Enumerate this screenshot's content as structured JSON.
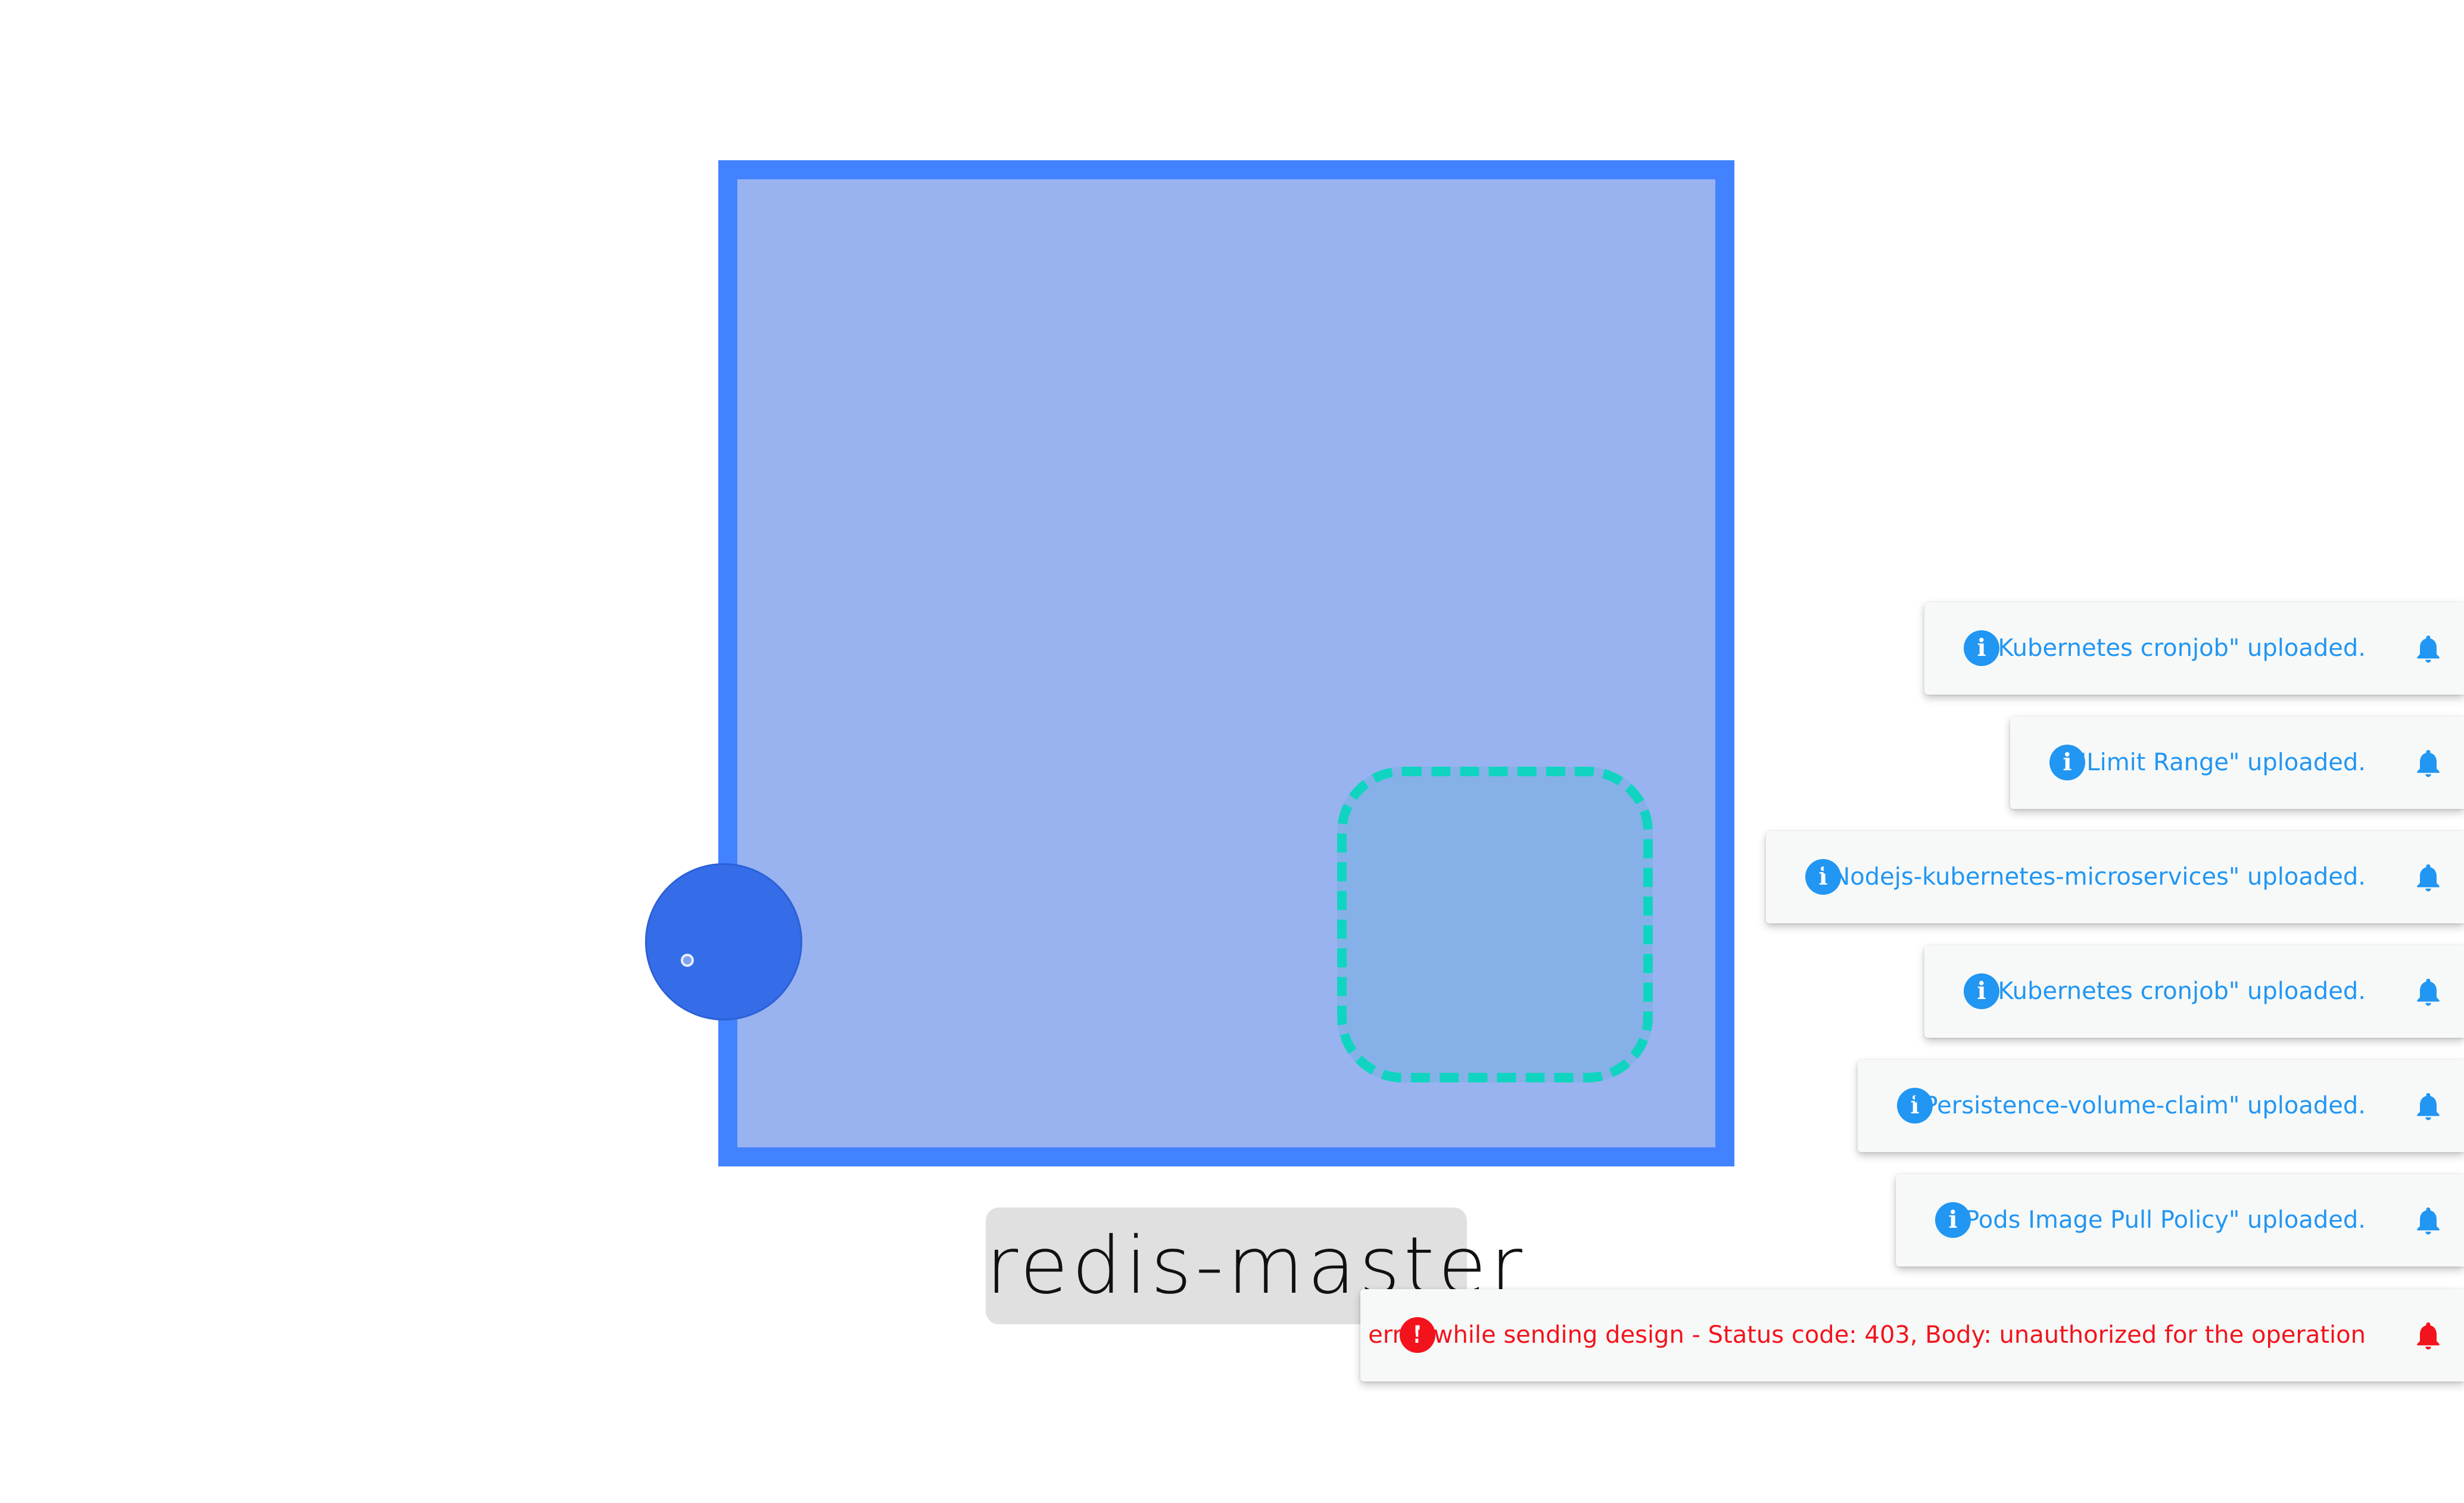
{
  "node": {
    "label": "redis-master"
  },
  "notifications": [
    {
      "type": "info",
      "icon": "info-icon",
      "message": "\"Kubernetes cronjob\" uploaded."
    },
    {
      "type": "info",
      "icon": "info-icon",
      "message": "\"Limit Range\" uploaded."
    },
    {
      "type": "info",
      "icon": "info-icon",
      "message": "\"Nodejs-kubernetes-microservices\" uploaded."
    },
    {
      "type": "info",
      "icon": "info-icon",
      "message": "\"Kubernetes cronjob\" uploaded."
    },
    {
      "type": "info",
      "icon": "info-icon",
      "message": "\"Persistence-volume-claim\" uploaded."
    },
    {
      "type": "info",
      "icon": "info-icon",
      "message": "\"Pods Image Pull Policy\" uploaded."
    },
    {
      "type": "error",
      "icon": "error-icon",
      "message": "error while sending design - Status code: 403, Body: unauthorized for the operation"
    }
  ],
  "colors": {
    "node_border": "#4282ff",
    "node_fill": "#98b3f0",
    "slot_border": "#10d4c0",
    "handle": "#356de9",
    "info": "#2196f3",
    "error": "#f3131c"
  }
}
